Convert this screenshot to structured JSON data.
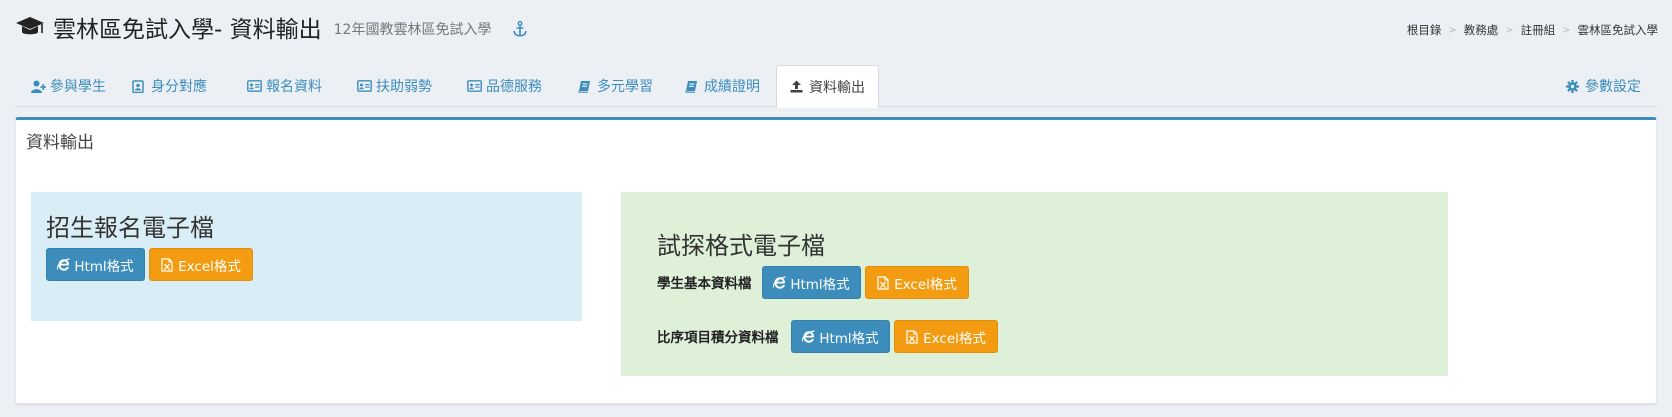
{
  "header": {
    "title": "雲林區免試入學- 資料輸出",
    "subtitle": "12年國教雲林區免試入學",
    "icons": {
      "title": "graduation-cap-icon",
      "anchor": "anchor-icon"
    }
  },
  "breadcrumb": [
    "根目錄",
    "教務處",
    "註冊組",
    "雲林區免試入學"
  ],
  "tabs": [
    {
      "label": "參與學生",
      "icon": "user-plus-icon"
    },
    {
      "label": "身分對應",
      "icon": "id-badge-icon"
    },
    {
      "label": "報名資料",
      "icon": "id-card-icon"
    },
    {
      "label": "扶助弱勢",
      "icon": "id-card-icon"
    },
    {
      "label": "品德服務",
      "icon": "id-card-icon"
    },
    {
      "label": "多元學習",
      "icon": "book-icon"
    },
    {
      "label": "成績證明",
      "icon": "book-icon"
    },
    {
      "label": "資料輸出",
      "icon": "upload-icon",
      "active": true
    }
  ],
  "settings_tab": {
    "label": "參數設定",
    "icon": "gear-icon"
  },
  "box": {
    "title": "資料輸出"
  },
  "enroll_panel": {
    "title": "招生報名電子檔",
    "html_label": "Html格式",
    "excel_label": "Excel格式"
  },
  "trial_panel": {
    "title": "試探格式電子檔",
    "rows": [
      {
        "label": "學生基本資料檔",
        "html_label": "Html格式",
        "excel_label": "Excel格式"
      },
      {
        "label": "比序項目積分資料檔",
        "html_label": "Html格式",
        "excel_label": "Excel格式"
      }
    ]
  },
  "colors": {
    "accent": "#3c8dbc",
    "warning": "#f39c12",
    "info_bg": "#d9edf7",
    "success_bg": "#dff0d8",
    "page_bg": "#ecf0f5"
  }
}
